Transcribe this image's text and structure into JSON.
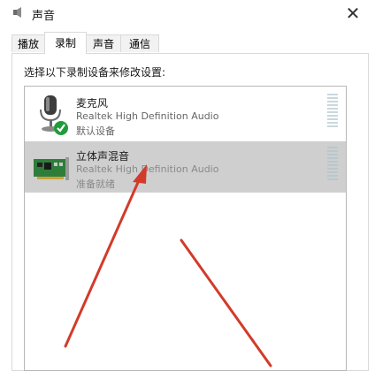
{
  "window": {
    "title": "声音",
    "close_glyph": "✕"
  },
  "tabs": [
    {
      "label": "播放",
      "active": false
    },
    {
      "label": "录制",
      "active": true
    },
    {
      "label": "声音",
      "active": false
    },
    {
      "label": "通信",
      "active": false
    }
  ],
  "recording": {
    "instruction": "选择以下录制设备来修改设置:",
    "devices": [
      {
        "name": "麦克风",
        "driver": "Realtek High Definition Audio",
        "status": "默认设备",
        "icon": "microphone-icon",
        "default_check": true,
        "selected": false
      },
      {
        "name": "立体声混音",
        "driver": "Realtek High Definition Audio",
        "status": "准备就绪",
        "icon": "sound-card-icon",
        "default_check": false,
        "selected": true
      }
    ]
  },
  "colors": {
    "selected_row": "#cfcfcf",
    "arrow": "#d23b2a",
    "check": "#1e9c3a"
  }
}
